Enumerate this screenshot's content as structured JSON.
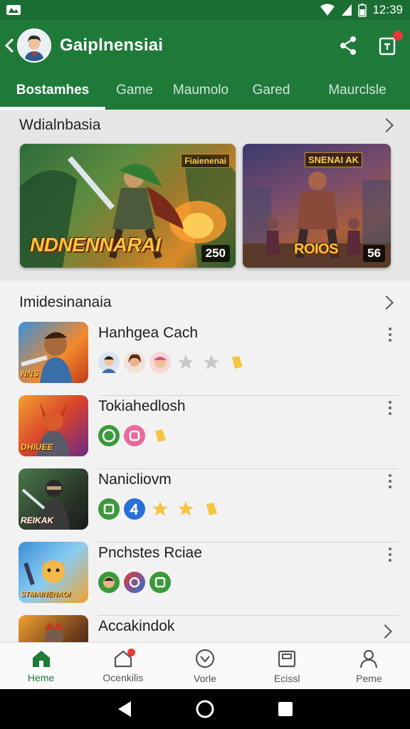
{
  "status": {
    "time": "12:39"
  },
  "app": {
    "title": "Gaiplnensiai"
  },
  "tabs": [
    {
      "label": "Bostamhes",
      "active": true
    },
    {
      "label": "Game"
    },
    {
      "label": "Maumolo"
    },
    {
      "label": "Gared"
    },
    {
      "label": "Maurclsle"
    }
  ],
  "featured": {
    "title": "Wdialnbasia",
    "cards": [
      {
        "title": "NDNENNARAI",
        "tag": "Fiaienenai",
        "count": "250"
      },
      {
        "title": "ROIOS",
        "tag": "SNENAI AK",
        "count": "56"
      }
    ]
  },
  "list": {
    "title": "Imidesinanaia",
    "items": [
      {
        "title": "Hanhgea Cach",
        "thumb_label": "NNS"
      },
      {
        "title": "Tokiahedlosh",
        "thumb_label": "DHIUEE"
      },
      {
        "title": "Nanicliovm",
        "thumb_label": "REIKAK"
      },
      {
        "title": "Pnchstes Rciae",
        "thumb_label": "STMAINENAOI"
      },
      {
        "title": "Accakindok",
        "thumb_label": ""
      }
    ]
  },
  "bottom_nav": [
    {
      "label": "Heme",
      "icon": "home-icon",
      "active": true
    },
    {
      "label": "Ocenkilis",
      "icon": "house-outline-icon"
    },
    {
      "label": "Vorle",
      "icon": "controller-icon"
    },
    {
      "label": "Ecissl",
      "icon": "library-icon"
    },
    {
      "label": "Peme",
      "icon": "person-icon"
    }
  ],
  "colors": {
    "primary": "#1f7a3a",
    "status_bar": "#1b6e33",
    "accent_star": "#f5c542"
  }
}
